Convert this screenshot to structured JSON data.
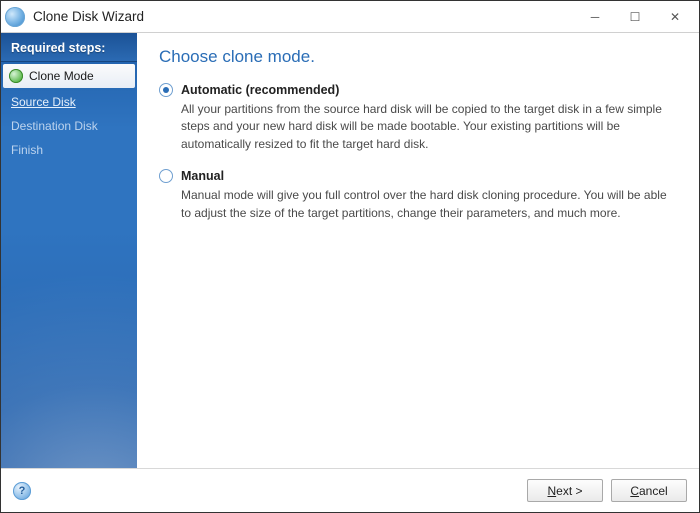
{
  "window": {
    "title": "Clone Disk Wizard"
  },
  "sidebar": {
    "header": "Required steps:",
    "steps": {
      "clone_mode": "Clone Mode",
      "source_disk": "Source Disk",
      "destination_disk": "Destination Disk",
      "finish": "Finish"
    }
  },
  "content": {
    "page_title": "Choose clone mode.",
    "options": {
      "automatic": {
        "label": "Automatic (recommended)",
        "desc": "All your partitions from the source hard disk will be copied to the target disk in a few simple steps and your new hard disk will be made bootable. Your existing partitions will be automatically resized to fit the target hard disk."
      },
      "manual": {
        "label": "Manual",
        "desc": "Manual mode will give you full control over the hard disk cloning procedure. You will be able to adjust the size of the target partitions, change their parameters, and much more."
      }
    }
  },
  "footer": {
    "next": "Next >",
    "cancel": "Cancel"
  }
}
